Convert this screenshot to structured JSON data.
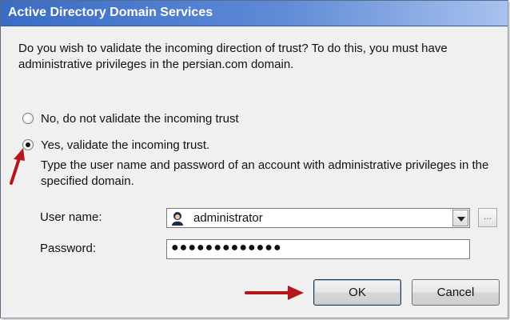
{
  "window": {
    "title": "Active Directory Domain Services"
  },
  "prompt": "Do you wish to validate the incoming direction of trust? To do this, you must have administrative privileges in the persian.com domain.",
  "options": [
    {
      "label": "No, do not validate the incoming trust",
      "selected": false
    },
    {
      "label": "Yes, validate the incoming trust.",
      "selected": true
    }
  ],
  "note": "Type the user name and password of an account with administrative privileges in the specified domain.",
  "fields": {
    "username": {
      "label": "User name:",
      "value": "administrator",
      "icon": "user-icon"
    },
    "password": {
      "label": "Password:",
      "masked_value": "●●●●●●●●●●●●●"
    },
    "browse_label": "..."
  },
  "buttons": {
    "ok": "OK",
    "cancel": "Cancel"
  },
  "colors": {
    "annotation_arrow": "#b5161a",
    "title_gradient_start": "#3a6cc5"
  }
}
